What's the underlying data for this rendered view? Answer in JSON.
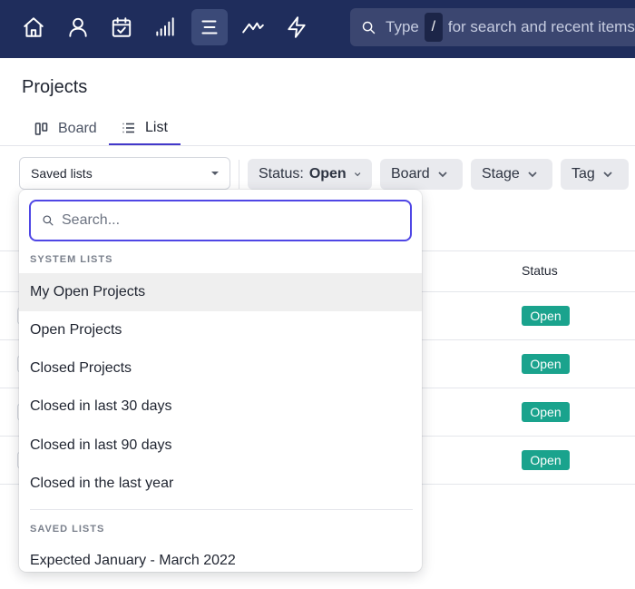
{
  "nav": {
    "icons": [
      "home-icon",
      "user-icon",
      "calendar-check-icon",
      "signal-bars-icon",
      "list-icon",
      "trend-icon",
      "lightning-icon"
    ],
    "search": {
      "prefix": "Type",
      "key": "/",
      "suffix": "for search and recent items..."
    }
  },
  "page": {
    "title": "Projects",
    "tabs": [
      {
        "label": "Board",
        "icon": "board-columns-icon"
      },
      {
        "label": "List",
        "icon": "list-icon",
        "active": true
      }
    ]
  },
  "filters": {
    "saved_lists": "Saved lists",
    "status_label": "Status:",
    "status_value": "Open",
    "board": "Board",
    "stage": "Stage",
    "tag": "Tag"
  },
  "table": {
    "status_header": "Status",
    "rows": [
      {
        "status": "Open"
      },
      {
        "status": "Open"
      },
      {
        "status": "Open"
      },
      {
        "status": "Open"
      }
    ]
  },
  "dropdown": {
    "search_placeholder": "Search...",
    "system_lists_label": "SYSTEM LISTS",
    "system_lists": [
      "My Open Projects",
      "Open Projects",
      "Closed Projects",
      "Closed in last 30 days",
      "Closed in last 90 days",
      "Closed in the last year"
    ],
    "saved_lists_label": "SAVED LISTS",
    "saved_lists": [
      "Expected January - March 2022"
    ]
  },
  "colors": {
    "nav_bg": "#1f2d5c",
    "accent": "#4f46e5",
    "status_open": "#1aa38d"
  }
}
